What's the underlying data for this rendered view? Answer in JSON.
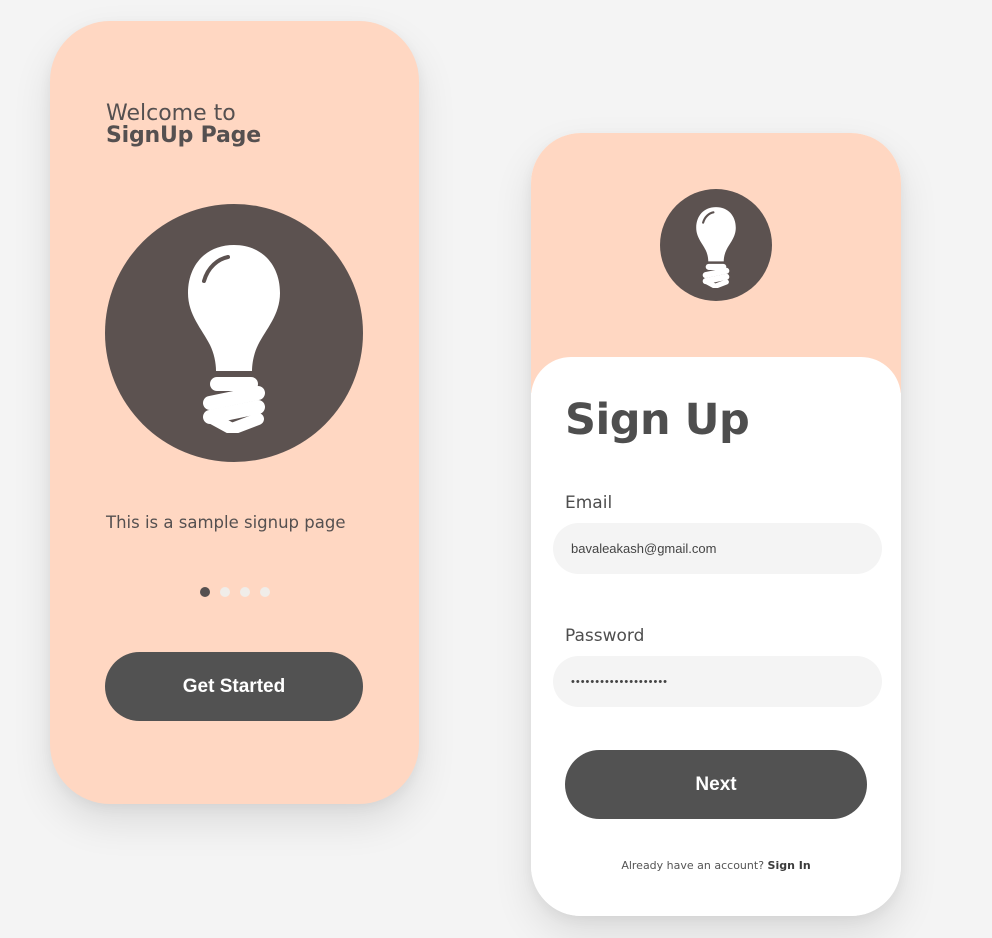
{
  "colors": {
    "background": "#f4f4f4",
    "card_peach": "#ffd7c2",
    "icon_circle": "#5c5250",
    "button": "#525252",
    "input_bg": "#f4f4f4",
    "text_dark": "#4e4e4e",
    "dot_inactive": "#f0ede9"
  },
  "welcome_screen": {
    "title_line1": "Welcome to",
    "title_line2": "SignUp Page",
    "hero_icon": "lightbulb-icon",
    "description": "This is a sample signup page",
    "pagination": {
      "total": 4,
      "active_index": 0
    },
    "cta_label": "Get Started"
  },
  "signup_screen": {
    "logo_icon": "lightbulb-icon",
    "title": "Sign Up",
    "email": {
      "label": "Email",
      "value": "bavaleakash@gmail.com"
    },
    "password": {
      "label": "Password",
      "value": "••••••••••••••••••••"
    },
    "next_label": "Next",
    "footer_prompt": "Already have an account?",
    "footer_link": "Sign In"
  }
}
